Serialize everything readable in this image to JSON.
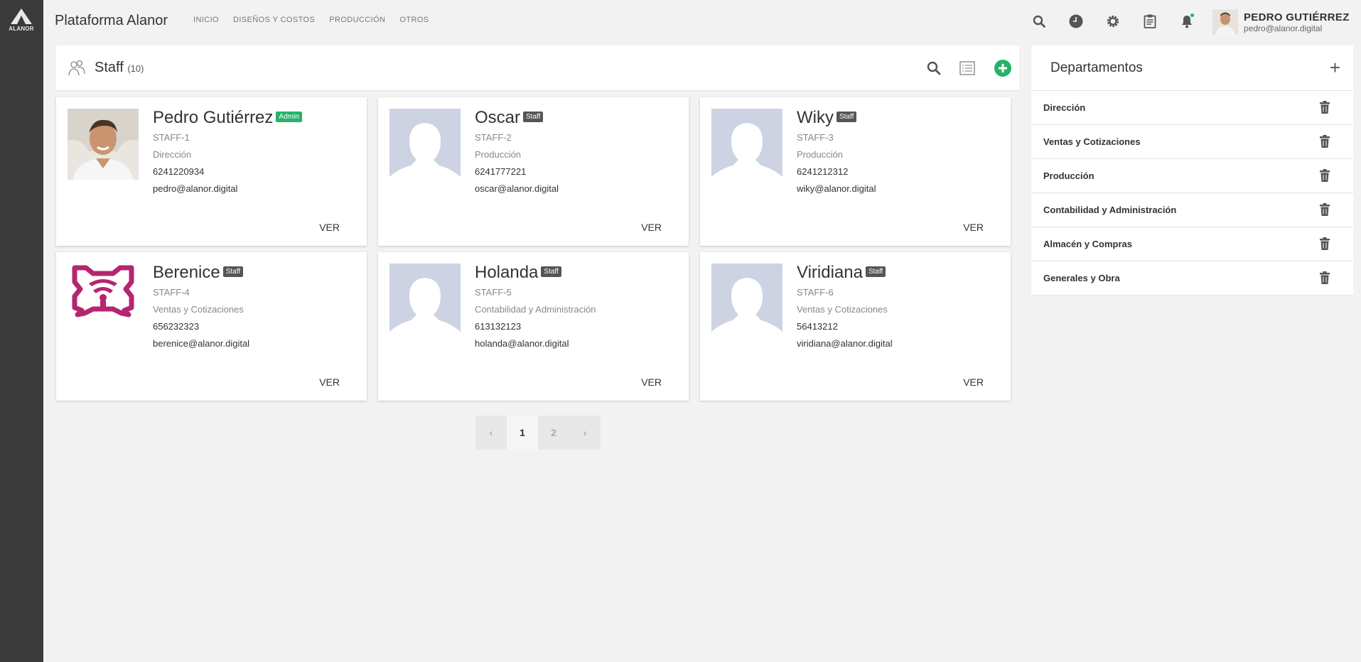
{
  "brand": {
    "logo_text": "ALANOR",
    "app_title": "Plataforma Alanor"
  },
  "nav": [
    {
      "label": "INICIO"
    },
    {
      "label": "DISEÑOS Y COSTOS"
    },
    {
      "label": "PRODUCCIÓN"
    },
    {
      "label": "OTROS"
    }
  ],
  "user": {
    "name": "PEDRO GUTIÉRREZ",
    "email": "pedro@alanor.digital"
  },
  "staff_header": {
    "title": "Staff",
    "count": "(10)"
  },
  "staff": [
    {
      "name": "Pedro Gutiérrez",
      "badge": "Admin",
      "code": "STAFF-1",
      "dept": "Dirección",
      "phone": "6241220934",
      "email": "pedro@alanor.digital",
      "action": "VER",
      "avatar": "photo"
    },
    {
      "name": "Oscar",
      "badge": "Staff",
      "code": "STAFF-2",
      "dept": "Producción",
      "phone": "6241777221",
      "email": "oscar@alanor.digital",
      "action": "VER",
      "avatar": "placeholder"
    },
    {
      "name": "Wiky",
      "badge": "Staff",
      "code": "STAFF-3",
      "dept": "Producción",
      "phone": "6241212312",
      "email": "wiky@alanor.digital",
      "action": "VER",
      "avatar": "placeholder"
    },
    {
      "name": "Berenice",
      "badge": "Staff",
      "code": "STAFF-4",
      "dept": "Ventas y Cotizaciones",
      "phone": "656232323",
      "email": "berenice@alanor.digital",
      "action": "VER",
      "avatar": "logo"
    },
    {
      "name": "Holanda",
      "badge": "Staff",
      "code": "STAFF-5",
      "dept": "Contabilidad y Administración",
      "phone": "613132123",
      "email": "holanda@alanor.digital",
      "action": "VER",
      "avatar": "placeholder"
    },
    {
      "name": "Viridiana",
      "badge": "Staff",
      "code": "STAFF-6",
      "dept": "Ventas y Cotizaciones",
      "phone": "56413212",
      "email": "viridiana@alanor.digital",
      "action": "VER",
      "avatar": "placeholder"
    }
  ],
  "pagination": {
    "prev": "‹",
    "pages": [
      "1",
      "2"
    ],
    "current": "1",
    "next": "›"
  },
  "departments": {
    "title": "Departamentos",
    "add_label": "+",
    "items": [
      {
        "label": "Dirección"
      },
      {
        "label": "Ventas y Cotizaciones"
      },
      {
        "label": "Producción"
      },
      {
        "label": "Contabilidad y Administración"
      },
      {
        "label": "Almacén y Compras"
      },
      {
        "label": "Generales y Obra"
      }
    ]
  },
  "colors": {
    "accent": "#26b36b",
    "rail": "#3a3a3a",
    "staff_badge": "#555555",
    "logo_magenta": "#b5266f",
    "placeholder": "#cdd3e3"
  }
}
